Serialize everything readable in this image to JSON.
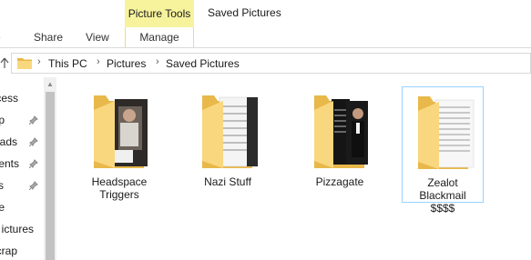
{
  "ribbon": {
    "context_tab_header": "Picture Tools",
    "window_title": "Saved Pictures",
    "tabs": {
      "home": "e",
      "share": "Share",
      "view": "View",
      "manage": "Manage"
    }
  },
  "address": {
    "crumbs": [
      "This PC",
      "Pictures",
      "Saved Pictures"
    ],
    "separator": "›"
  },
  "nav": {
    "items": [
      {
        "label": "ccess",
        "pinned": false
      },
      {
        "label": "p",
        "pinned": true
      },
      {
        "label": "ads",
        "pinned": true
      },
      {
        "label": "ents",
        "pinned": true
      },
      {
        "label": "s",
        "pinned": true
      },
      {
        "label": "e",
        "pinned": false
      },
      {
        "label": "ictures",
        "pinned": false
      },
      {
        "label": "crap",
        "pinned": false
      }
    ]
  },
  "folders": [
    {
      "name_line1": "Headspace",
      "name_line2": "Triggers",
      "selected": false
    },
    {
      "name_line1": "Nazi Stuff",
      "name_line2": "",
      "selected": false
    },
    {
      "name_line1": "Pizzagate",
      "name_line2": "",
      "selected": false
    },
    {
      "name_line1": "Zealot Blackmail",
      "name_line2": "$$$$",
      "selected": true
    }
  ],
  "colors": {
    "context_tab": "#f7f39c",
    "folder_back": "#e8b84a",
    "folder_front": "#f9d77e",
    "selection_border": "#99d1ff"
  }
}
